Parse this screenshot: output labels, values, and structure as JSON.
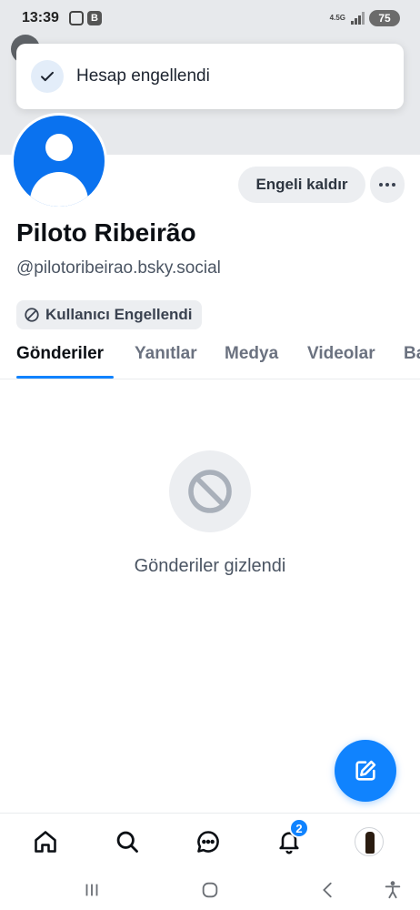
{
  "status_bar": {
    "time": "13:39",
    "network": "4.5G",
    "battery": "75"
  },
  "toast": {
    "message": "Hesap engellendi",
    "icon": "check-icon"
  },
  "profile": {
    "display_name": "Piloto Ribeirão",
    "handle": "@pilotoribeirao.bsky.social",
    "blocked_label": "Kullanıcı Engellendi",
    "avatar_color": "#0a72ef"
  },
  "actions": {
    "unblock_label": "Engeli kaldır",
    "more_icon": "ellipsis-icon"
  },
  "tabs": [
    {
      "label": "Gönderiler",
      "active": true
    },
    {
      "label": "Yanıtlar",
      "active": false
    },
    {
      "label": "Medya",
      "active": false
    },
    {
      "label": "Videolar",
      "active": false
    },
    {
      "label": "Ba",
      "active": false
    }
  ],
  "empty_state": {
    "message": "Gönderiler gizlendi",
    "icon": "ban-icon"
  },
  "fab": {
    "icon": "compose-icon"
  },
  "bottom_nav": {
    "items": [
      {
        "icon": "home-icon"
      },
      {
        "icon": "search-icon"
      },
      {
        "icon": "chat-icon"
      },
      {
        "icon": "bell-icon",
        "badge": "2"
      },
      {
        "icon": "profile-avatar"
      }
    ]
  },
  "colors": {
    "accent": "#1083fe",
    "banner": "#e7e9ec",
    "pill_bg": "#eceef1"
  }
}
